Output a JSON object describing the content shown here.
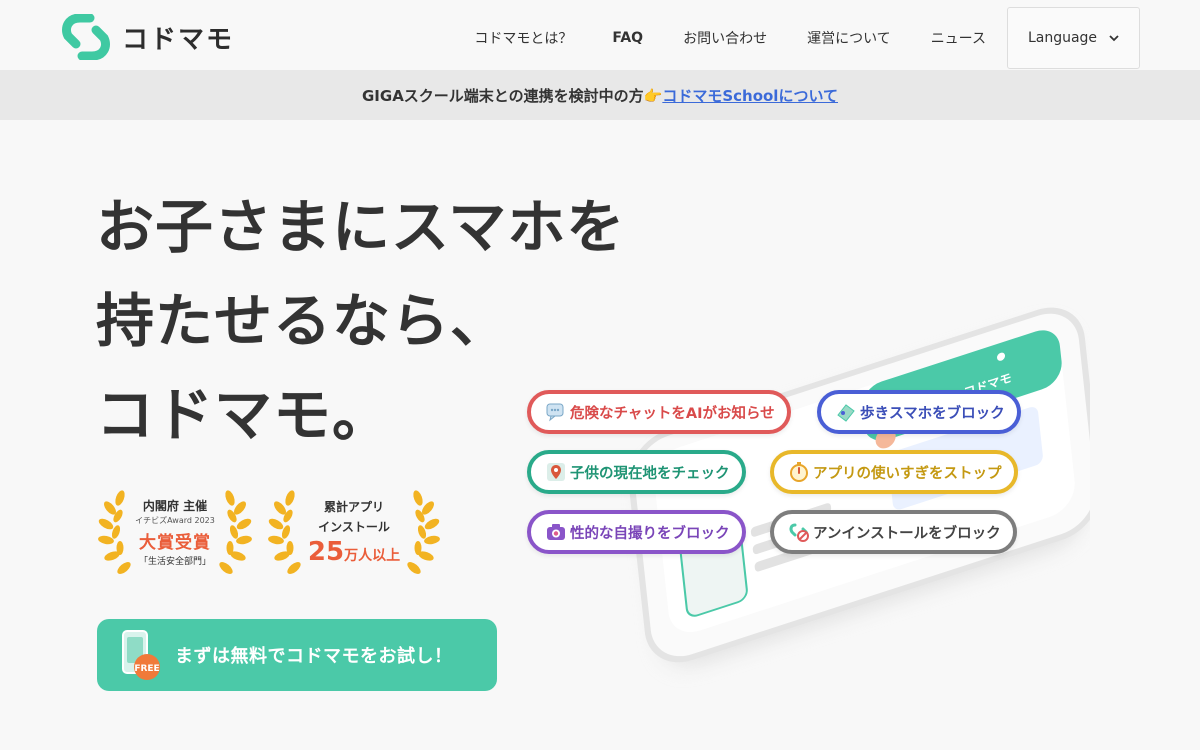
{
  "header": {
    "logo_text": "コドマモ",
    "nav": [
      {
        "label": "コドマモとは？",
        "bold": false
      },
      {
        "label": "FAQ",
        "bold": true
      },
      {
        "label": "お問い合わせ",
        "bold": false
      },
      {
        "label": "運営について",
        "bold": false
      },
      {
        "label": "ニュース",
        "bold": false
      }
    ],
    "language_label": "Language"
  },
  "banner": {
    "text": "GIGAスクール端末との連携を検討中の方👉",
    "link": "コドマモSchoolについて"
  },
  "hero": {
    "lines": [
      "お子さまにスマホを",
      "持たせるなら、",
      "コドマモ。"
    ]
  },
  "awards": {
    "award1": {
      "line1": "内閣府 主催",
      "line2": "イチビズAward 2023",
      "line3": "大賞受賞",
      "line4": "「生活安全部門」"
    },
    "award2": {
      "line1": "累計アプリ",
      "line2": "インストール",
      "number": "25",
      "unit": "万人以上"
    }
  },
  "cta": {
    "label": "まずは無料でコドマモをお試し！",
    "badge": "FREE"
  },
  "phone": {
    "logo_text": "コドマモ"
  },
  "features": [
    {
      "label": "危険なチャットをAIがお知らせ",
      "color": "#e05a5a",
      "icon": "chat-bubble-icon"
    },
    {
      "label": "歩きスマホをブロック",
      "color": "#4a5fd6",
      "icon": "walking-phone-icon"
    },
    {
      "label": "子供の現在地をチェック",
      "color": "#2aaa8a",
      "icon": "map-pin-icon"
    },
    {
      "label": "アプリの使いすぎをストップ",
      "color": "#e8b82a",
      "icon": "stopwatch-icon"
    },
    {
      "label": "性的な自撮りをブロック",
      "color": "#8a55c9",
      "icon": "camera-icon"
    },
    {
      "label": "アンインストールをブロック",
      "color": "#7d7d7d",
      "icon": "uninstall-block-icon"
    }
  ]
}
